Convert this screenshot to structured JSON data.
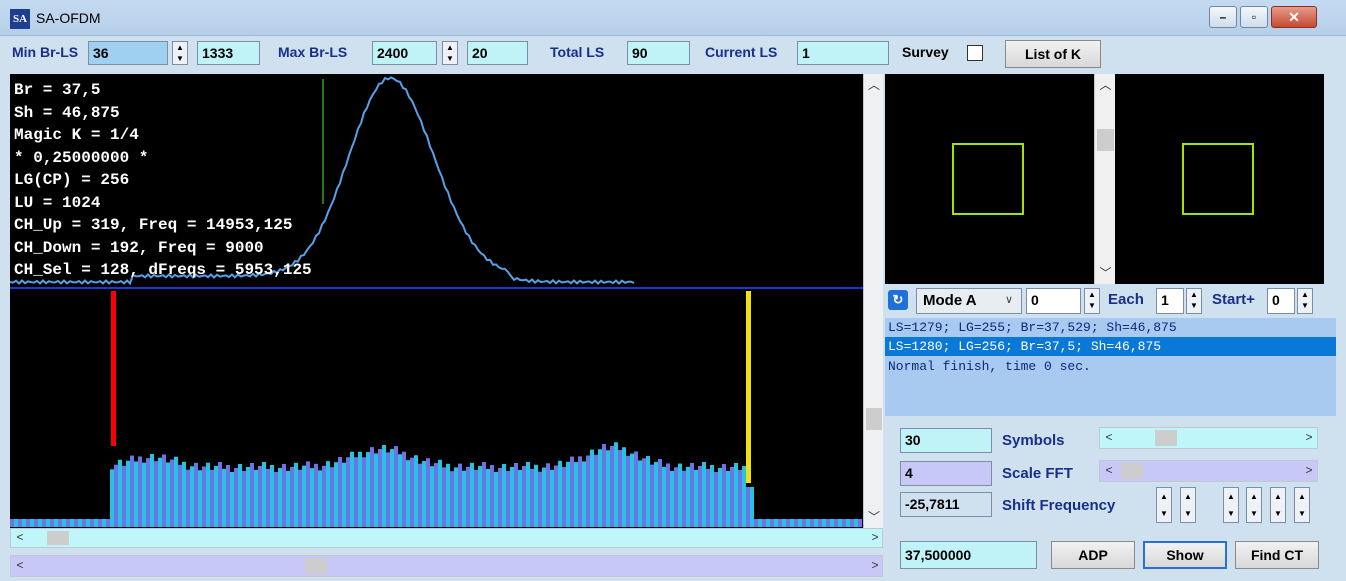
{
  "window": {
    "title": "SA-OFDM",
    "icon_text": "SA"
  },
  "toolbar": {
    "min_br_ls_label": "Min Br-LS",
    "min_br_ls_value": "36",
    "min_br_ls_extra": "1333",
    "max_br_ls_label": "Max Br-LS",
    "max_br_ls_value": "2400",
    "max_br_ls_extra": "20",
    "total_ls_label": "Total LS",
    "total_ls_value": "90",
    "current_ls_label": "Current LS",
    "current_ls_value": "1",
    "survey_label": "Survey",
    "list_of_k_label": "List of K"
  },
  "info": [
    "Br = 37,5",
    "Sh = 46,875",
    "Magic K = 1/4",
    "* 0,25000000 *",
    "LG(CP) = 256",
    "LU = 1024",
    "CH_Up = 319, Freq = 14953,125",
    "CH_Down = 192, Freq = 9000",
    "CH_Sel = 128, dFreqs = 5953,125"
  ],
  "controls": {
    "mode_value": "Mode A",
    "mode_number": "0",
    "each_label": "Each",
    "each_value": "1",
    "start_label": "Start+",
    "start_value": "0"
  },
  "log": [
    "LS=1279; LG=255; Br=37,529; Sh=46,875",
    "LS=1280; LG=256; Br=37,5; Sh=46,875",
    "Normal finish, time 0 sec."
  ],
  "symbols": {
    "value": "30",
    "label": "Symbols",
    "level": 0.23
  },
  "scale_fft": {
    "value": "4",
    "label": "Scale FFT",
    "level": 0.02
  },
  "shift": {
    "value": "-25,7811",
    "label": "Shift Frequency"
  },
  "bottom": {
    "freq_value": "37,500000",
    "adp_label": "ADP",
    "show_label": "Show",
    "find_ct_label": "Find CT"
  },
  "colors": {
    "curve": "#5aa0e6",
    "bar_a": "#24c3e3",
    "bar_b": "#6e73e6",
    "marker_left": "#ff0000",
    "marker_right": "#f0e010",
    "constellation": "#9ee600",
    "separator": "#1a38d8"
  },
  "icons": {
    "refresh": "refresh-icon",
    "spin": "spin-updown-icon",
    "chevron": "chevron-icon"
  }
}
